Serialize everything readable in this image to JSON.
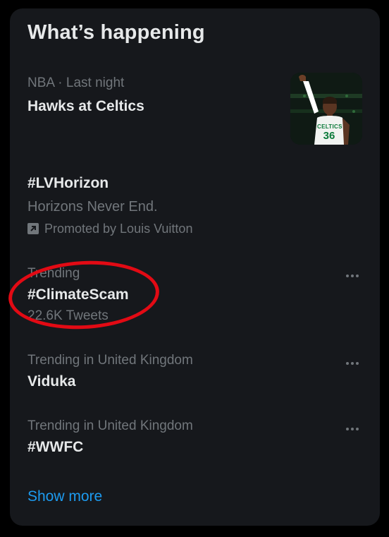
{
  "panel": {
    "title": "What’s happening",
    "show_more": "Show more"
  },
  "trends": [
    {
      "meta": "NBA · Last night",
      "headline": "Hawks at Celtics",
      "image": "basketball-player-celtics-36"
    },
    {
      "headline": "#LVHorizon",
      "subtitle": "Horizons Never End.",
      "promoted": "Promoted by Louis Vuitton",
      "promo_icon": "promoted-arrow-icon"
    },
    {
      "meta": "Trending",
      "headline": "#ClimateScam",
      "count": "22.6K Tweets",
      "annotation": "red-hand-drawn-circle"
    },
    {
      "meta": "Trending in United Kingdom",
      "headline": "Viduka"
    },
    {
      "meta": "Trending in United Kingdom",
      "headline": "#WWFC"
    }
  ],
  "colors": {
    "background": "#000000",
    "panel": "#16181c",
    "primary_text": "#e7e9ea",
    "secondary_text": "#71767b",
    "link": "#1d9bf0",
    "annotation": "#e20a14"
  },
  "jersey_text": {
    "team": "CELTICS",
    "number": "36"
  }
}
